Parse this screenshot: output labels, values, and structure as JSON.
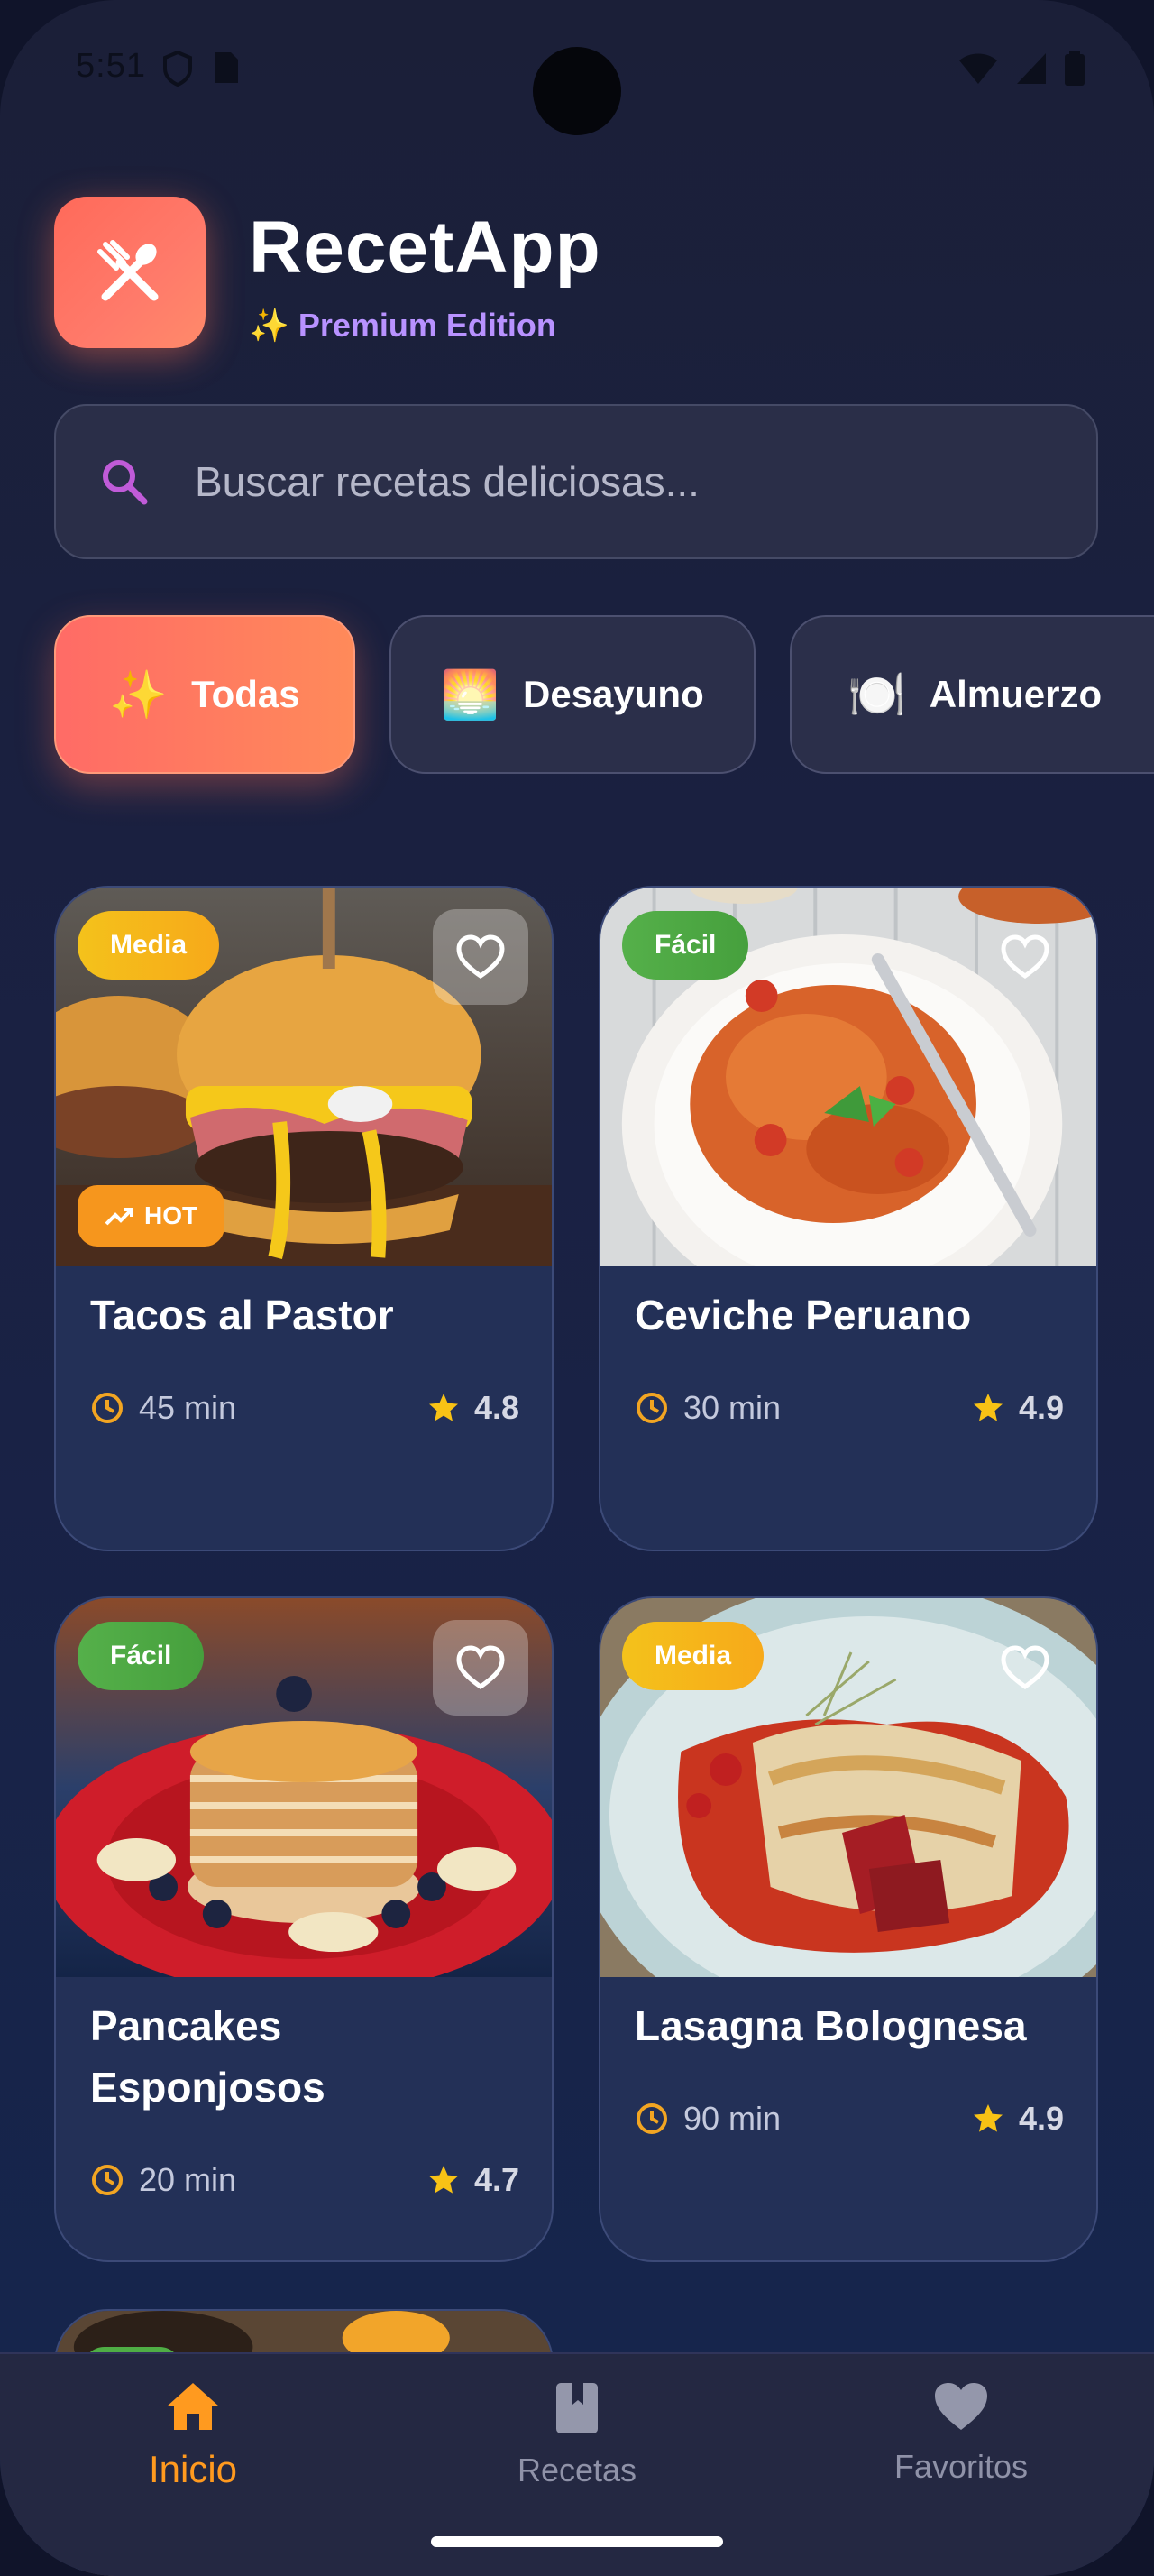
{
  "status_bar": {
    "time": "5:51"
  },
  "header": {
    "title": "RecetApp",
    "subtitle_icon": "✨",
    "subtitle": "Premium Edition"
  },
  "search": {
    "placeholder": "Buscar recetas deliciosas..."
  },
  "categories": [
    {
      "emoji": "✨",
      "label": "Todas",
      "active": true
    },
    {
      "emoji": "🌅",
      "label": "Desayuno",
      "active": false
    },
    {
      "emoji": "🍽️",
      "label": "Almuerzo",
      "active": false
    }
  ],
  "recipes": [
    {
      "title": "Tacos al Pastor",
      "time": "45 min",
      "rating": "4.8",
      "difficulty": "Media",
      "hot": "HOT"
    },
    {
      "title": "Ceviche Peruano",
      "time": "30 min",
      "rating": "4.9",
      "difficulty": "Fácil"
    },
    {
      "title": "Pancakes Esponjosos",
      "time": "20 min",
      "rating": "4.7",
      "difficulty": "Fácil"
    },
    {
      "title": "Lasagna Bolognesa",
      "time": "90 min",
      "rating": "4.9",
      "difficulty": "Media"
    }
  ],
  "nav": {
    "home": "Inicio",
    "recipes": "Recetas",
    "favorites": "Favoritos"
  },
  "colors": {
    "accent": "#ff9a1f",
    "brand": "#ff6a5a",
    "subtitle": "#b892ff",
    "card_bg": "#233057",
    "page_bg": "#1b1f38"
  },
  "icons": {
    "logo": "fork-spoon-icon",
    "search": "search-icon",
    "favorite": "heart-outline-icon",
    "time": "clock-icon",
    "rating": "star-icon",
    "trend": "trending-up-icon",
    "home": "home-icon",
    "book": "book-icon",
    "heart": "heart-icon"
  }
}
